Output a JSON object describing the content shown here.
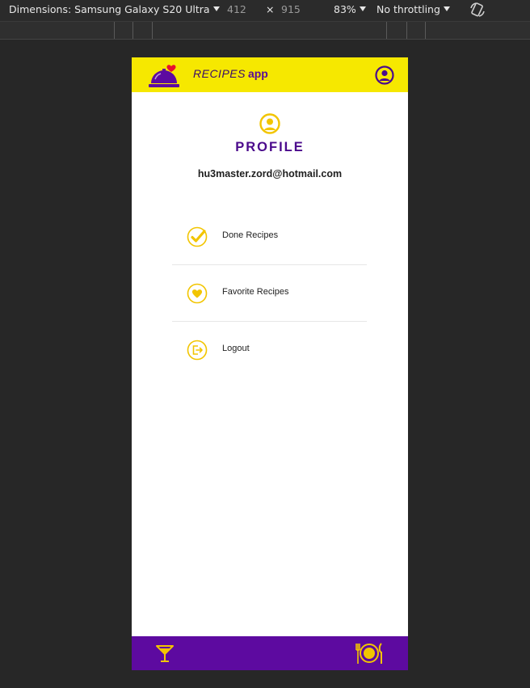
{
  "devtools": {
    "dimensions_label": "Dimensions: Samsung Galaxy S20 Ultra",
    "width": "412",
    "times": "×",
    "height": "915",
    "zoom": "83%",
    "throttling": "No throttling"
  },
  "app": {
    "brand_name": "RECIPES",
    "brand_suffix": "app",
    "accent_yellow": "#f6e800",
    "accent_purple": "#5d0aa0"
  },
  "profile": {
    "title": "PROFILE",
    "email": "hu3master.zord@hotmail.com"
  },
  "menu": [
    {
      "label": "Done Recipes",
      "icon": "check-circle-icon"
    },
    {
      "label": "Favorite Recipes",
      "icon": "heart-circle-icon"
    },
    {
      "label": "Logout",
      "icon": "logout-icon"
    }
  ],
  "footer": {
    "left_icon": "cocktail-icon",
    "right_icon": "meal-plate-icon"
  }
}
